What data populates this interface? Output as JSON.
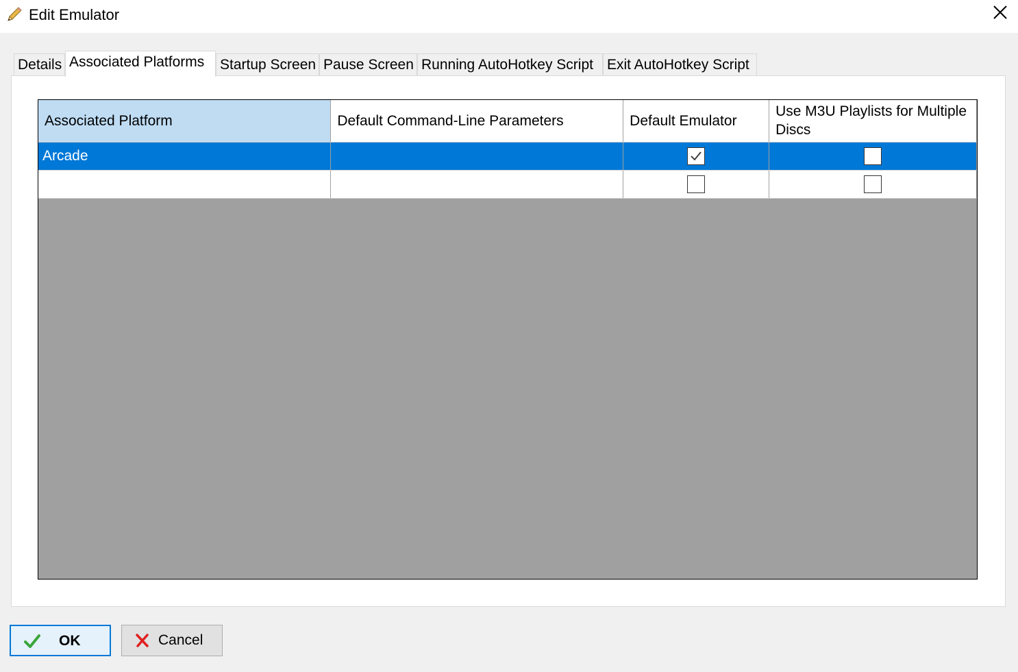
{
  "window": {
    "title": "Edit Emulator",
    "title_icon": "pencil-icon",
    "close_icon": "close-icon"
  },
  "tabs": [
    {
      "label": "Details",
      "active": false
    },
    {
      "label": "Associated Platforms",
      "active": true
    },
    {
      "label": "Startup Screen",
      "active": false
    },
    {
      "label": "Pause Screen",
      "active": false
    },
    {
      "label": "Running AutoHotkey Script",
      "active": false
    },
    {
      "label": "Exit AutoHotkey Script",
      "active": false
    }
  ],
  "grid": {
    "columns": [
      "Associated Platform",
      "Default Command-Line Parameters",
      "Default Emulator",
      "Use M3U Playlists for Multiple Discs"
    ],
    "rows": [
      {
        "platform": "Arcade",
        "parameters": "",
        "default_emulator": true,
        "use_m3u": false,
        "selected": true
      },
      {
        "platform": "",
        "parameters": "",
        "default_emulator": false,
        "use_m3u": false,
        "selected": false
      }
    ]
  },
  "buttons": {
    "ok_label": "OK",
    "ok_icon": "checkmark-icon",
    "cancel_label": "Cancel",
    "cancel_icon": "x-icon"
  },
  "colors": {
    "selection": "#0078d7",
    "selected_header": "#bfdcf3",
    "grid_background": "#a0a0a0"
  }
}
